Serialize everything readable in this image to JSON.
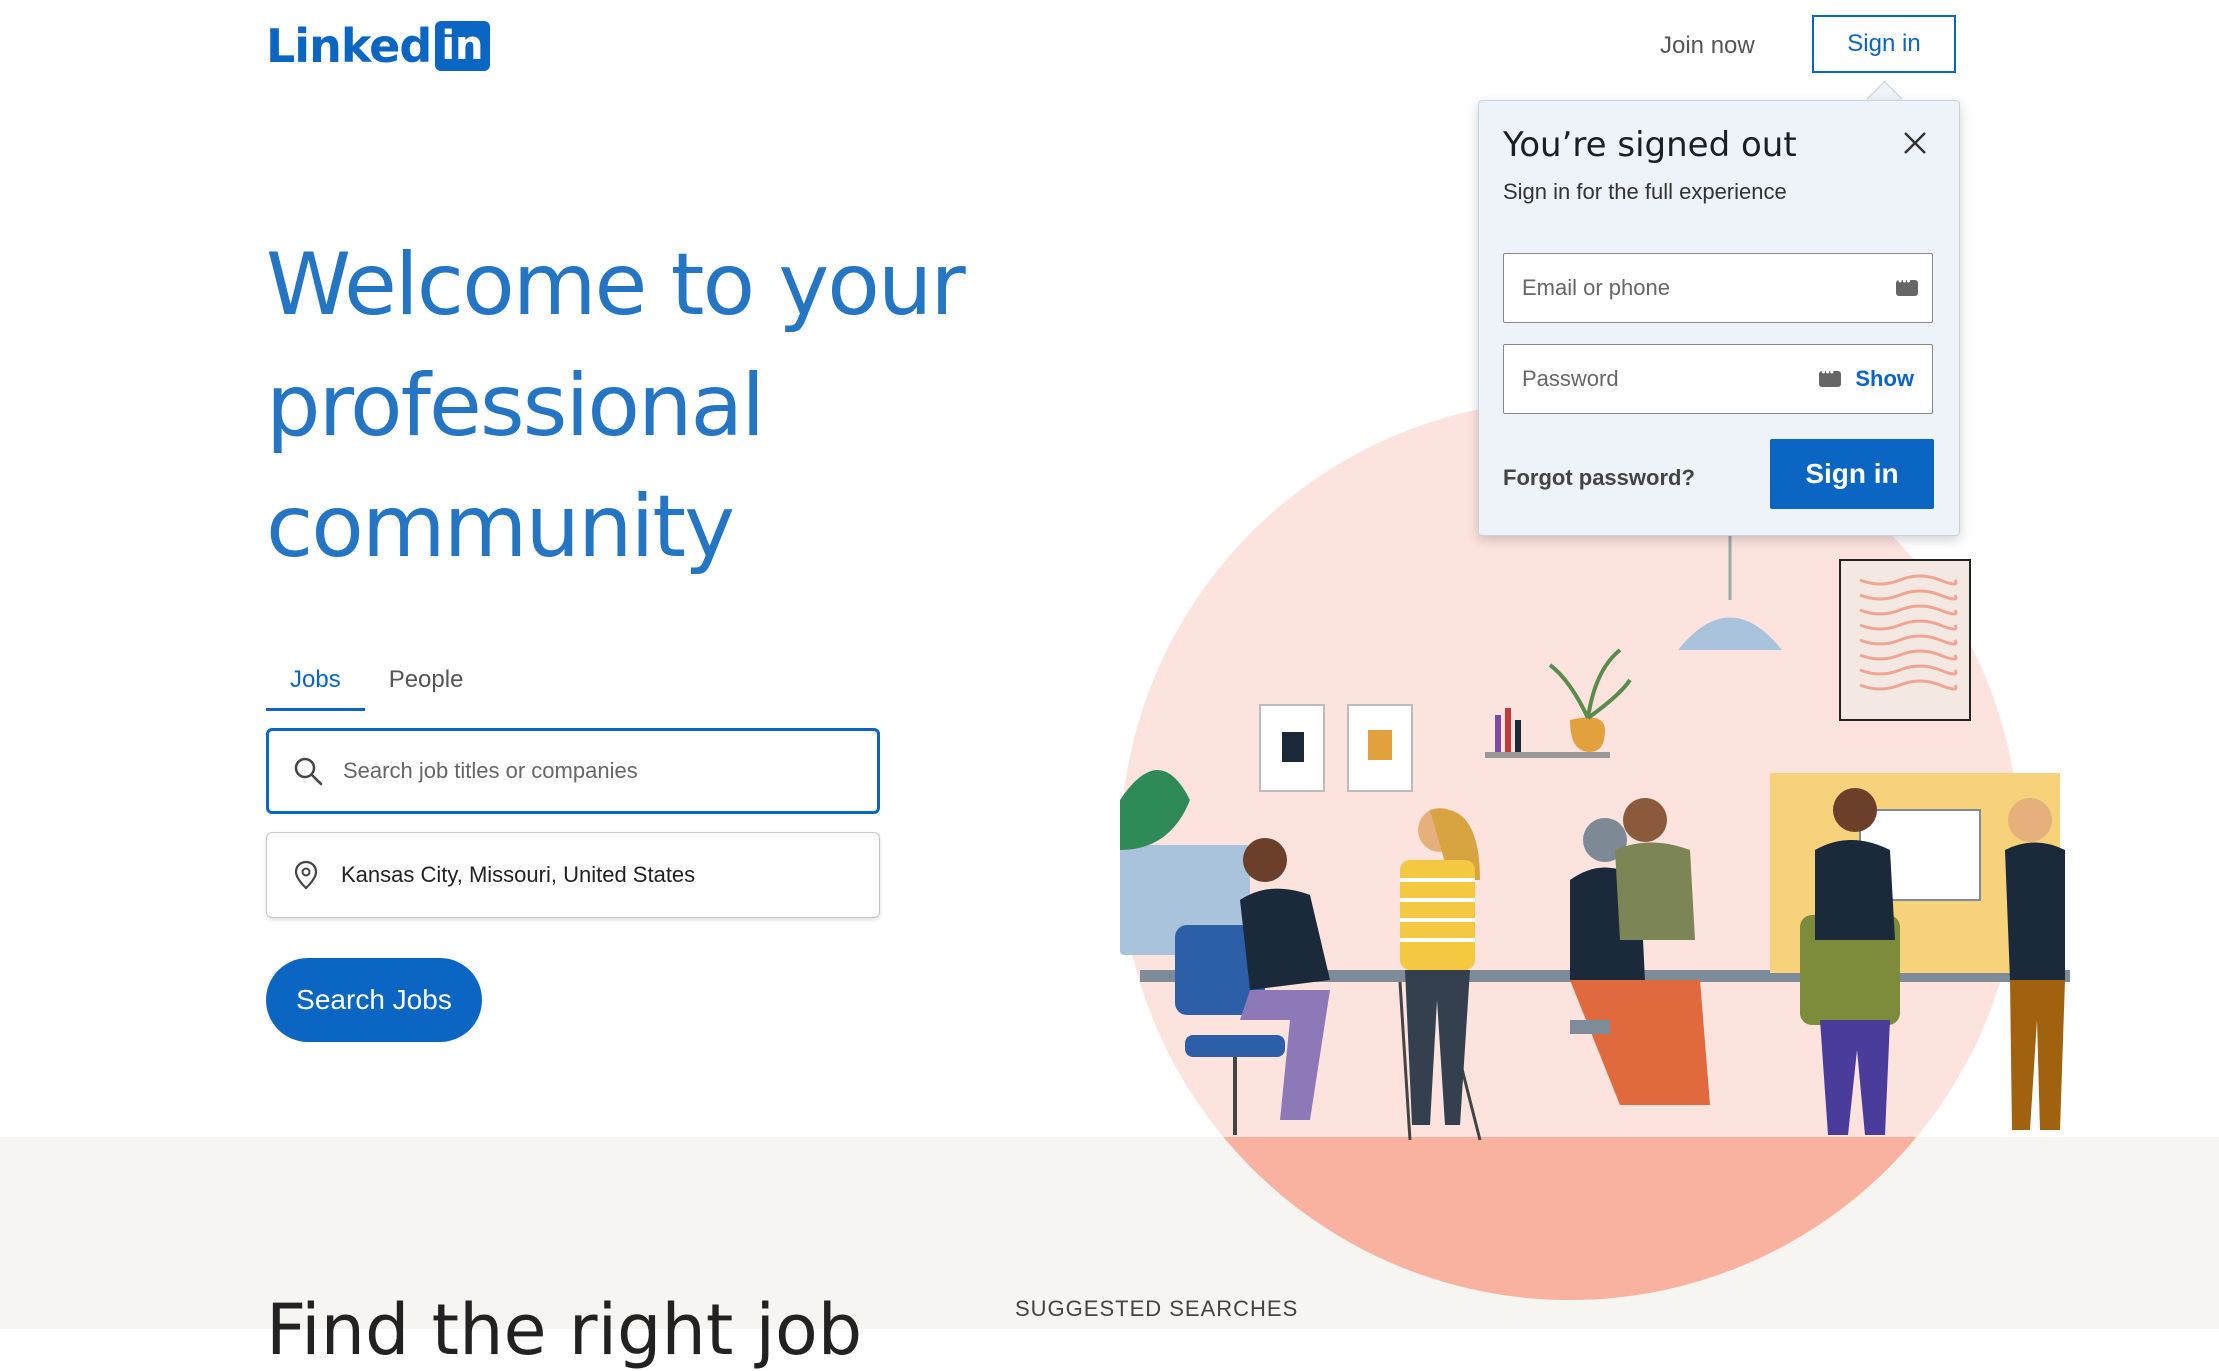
{
  "header": {
    "logo_text": "Linked",
    "logo_in": "in",
    "join_now": "Join now",
    "sign_in": "Sign in"
  },
  "hero": {
    "title_lines": [
      "Welcome to your",
      "professional",
      "community"
    ]
  },
  "search": {
    "tabs": [
      {
        "label": "Jobs",
        "active": true
      },
      {
        "label": "People",
        "active": false
      }
    ],
    "keyword_placeholder": "Search job titles or companies",
    "location_value": "Kansas City, Missouri, United States",
    "button_label": "Search Jobs"
  },
  "bottom": {
    "find_text": "Find the right job",
    "suggested_label": "SUGGESTED SEARCHES"
  },
  "popup": {
    "title": "You’re signed out",
    "subtitle": "Sign in for the full experience",
    "email_placeholder": "Email or phone",
    "password_placeholder": "Password",
    "show_label": "Show",
    "forgot_label": "Forgot password?",
    "sign_in_label": "Sign in"
  },
  "colors": {
    "brand_blue": "#0a66c2",
    "title_blue": "#2475c4",
    "illustration_circle": "#fde3de",
    "illustration_circle_dark": "#f9b29f",
    "band_background": "#f7f5f2"
  }
}
